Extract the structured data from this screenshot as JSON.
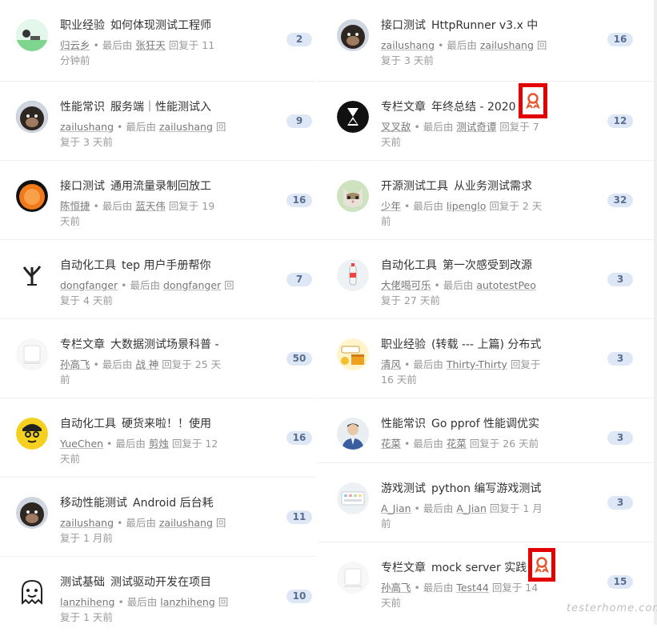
{
  "left_topics": [
    {
      "node": "职业经验",
      "title": "如何体现测试工程师",
      "meta1": [
        "归云乡",
        " • 最后由 ",
        "张狂天",
        " 回复于 11"
      ],
      "meta2": "分钟前",
      "count": "2",
      "avatar": "grass-avatar"
    },
    {
      "node": "性能常识",
      "title": "服务端｜性能测试入",
      "meta1": [
        "zailushang",
        " • 最后由 ",
        "zailushang",
        " 回"
      ],
      "meta2": "复于 3 天前",
      "count": "9",
      "avatar": "chimp-avatar"
    },
    {
      "node": "接口测试",
      "title": "通用流量录制回放工",
      "meta1": [
        "陈恒捷",
        " • 最后由 ",
        "蓝天伟",
        " 回复于 19"
      ],
      "meta2": "天前",
      "count": "16",
      "avatar": "orange-avatar"
    },
    {
      "node": "自动化工具",
      "title": "tep 用户手册帮你",
      "meta1": [
        "dongfanger",
        " • 最后由 ",
        "dongfanger",
        " 回"
      ],
      "meta2": "复于 4 天前",
      "count": "7",
      "avatar": "tree-avatar"
    },
    {
      "node": "专栏文章",
      "title": "大数据测试场景科普 -",
      "meta1": [
        "孙高飞",
        " • 最后由 ",
        "战 神",
        " 回复于 25 天"
      ],
      "meta2": "前",
      "count": "50",
      "avatar": "white-avatar"
    },
    {
      "node": "自动化工具",
      "title": "硬货来啦！！使用",
      "meta1": [
        "YueChen",
        " • 最后由 ",
        "剪烛",
        " 回复于 12"
      ],
      "meta2": "天前",
      "count": "16",
      "avatar": "face-avatar"
    },
    {
      "node": "移动性能测试",
      "title": "Android 后台耗",
      "meta1": [
        "zailushang",
        " • 最后由 ",
        "zailushang",
        " 回"
      ],
      "meta2": "复于 1 月前",
      "count": "11",
      "avatar": "chimp-avatar"
    },
    {
      "node": "测试基础",
      "title": "测试驱动开发在项目",
      "meta1": [
        "lanzhiheng",
        " • 最后由 ",
        "lanzhiheng",
        " 回"
      ],
      "meta2": "复于 1 天前",
      "count": "10",
      "avatar": "ghost-avatar"
    }
  ],
  "right_topics": [
    {
      "node": "接口测试",
      "title": "HttpRunner v3.x 中",
      "meta1": [
        "zailushang",
        " • 最后由 ",
        "zailushang",
        " 回"
      ],
      "meta2": "复于 3 天前",
      "count": "16",
      "avatar": "chimp-avatar"
    },
    {
      "node": "专栏文章",
      "title": "年终总结 - 2020",
      "meta1": [
        "叉叉敌",
        " • 最后由 ",
        "测试奇谭",
        " 回复于 7"
      ],
      "meta2": "天前",
      "count": "12",
      "avatar": "hourglass-avatar"
    },
    {
      "node": "开源测试工具",
      "title": "从业务测试需求",
      "meta1": [
        "少年",
        " • 最后由 ",
        "lipenglo",
        " 回复于 2 天"
      ],
      "meta2": "前",
      "count": "32",
      "avatar": "cat-avatar"
    },
    {
      "node": "自动化工具",
      "title": "第一次感受到改源",
      "meta1": [
        "大佬喝可乐",
        " • 最后由 ",
        "autotestPeo",
        " 回复于"
      ],
      "meta2": "复于 27 天前",
      "count": "3",
      "avatar": "bottle-avatar"
    },
    {
      "node": "职业经验",
      "title": "(转载 --- 上篇) 分布式",
      "meta1": [
        "清风",
        " • 最后由 ",
        "Thirty-Thirty",
        " 回复于"
      ],
      "meta2": "16 天前",
      "count": "3",
      "avatar": "python-avatar"
    },
    {
      "node": "性能常识",
      "title": "Go pprof 性能调优实",
      "meta1": [
        "花菜",
        " • 最后由 ",
        "花菜",
        " 回复于 26 天前"
      ],
      "meta2": "",
      "count": "3",
      "avatar": "man-avatar"
    },
    {
      "node": "游戏测试",
      "title": "python 编写游戏测试",
      "meta1": [
        "A_Jian",
        " • 最后由 ",
        "A_Jian",
        " 回复于 1 月"
      ],
      "meta2": "前",
      "count": "3",
      "avatar": "keyboard-avatar"
    },
    {
      "node": "专栏文章",
      "title": "mock server 实践",
      "meta1": [
        "孙高飞",
        " • 最后由 ",
        "Test44",
        " 回复于 14"
      ],
      "meta2": "天前",
      "count": "15",
      "avatar": "white-avatar"
    }
  ],
  "watermark": "testerhome.com",
  "colors": {
    "badge_border": "#e30000",
    "count_bg": "#dde7f6",
    "count_text": "#5a6c8f",
    "award": "#e8542b"
  },
  "icons": {
    "award": "award-ribbon-icon"
  }
}
